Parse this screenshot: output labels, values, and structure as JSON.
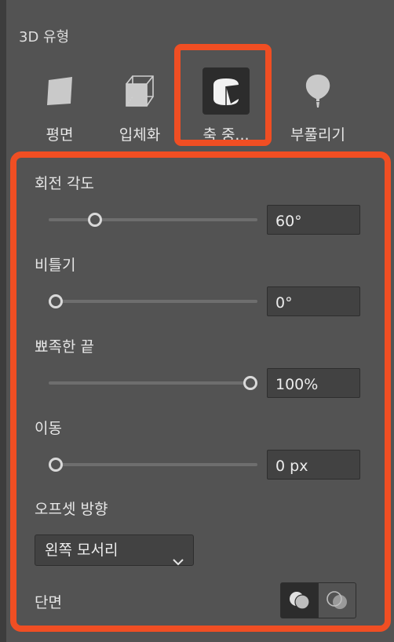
{
  "section_title": "3D 유형",
  "types": [
    {
      "label": "평면",
      "icon": "flat-icon",
      "selected": false
    },
    {
      "label": "입체화",
      "icon": "extrude-cube-icon",
      "selected": false
    },
    {
      "label": "축 중...",
      "icon": "revolve-icon",
      "selected": true
    },
    {
      "label": "부풀리기",
      "icon": "inflate-balloon-icon",
      "selected": false
    }
  ],
  "properties": {
    "rotation": {
      "label": "회전 각도",
      "value": "60°",
      "slider": 0.2
    },
    "twist": {
      "label": "비틀기",
      "value": "0°",
      "slider": 0.0
    },
    "taper": {
      "label": "뾰족한 끝",
      "value": "100%",
      "slider": 1.0
    },
    "move": {
      "label": "이동",
      "value": "0 px",
      "slider": 0.0
    }
  },
  "offset": {
    "label": "오프셋 방향",
    "selected": "왼쪽 모서리"
  },
  "cap": {
    "label": "단면",
    "active_index": 0
  },
  "colors": {
    "highlight": "#f04e23",
    "panel_bg": "#535353"
  }
}
